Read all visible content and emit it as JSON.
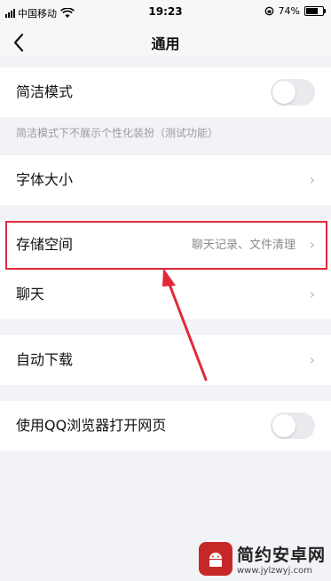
{
  "status_bar": {
    "carrier": "中国移动",
    "time": "19:23",
    "battery_text": "74%",
    "battery_level": 0.74
  },
  "nav": {
    "back_icon": "chevron-left-icon",
    "title": "通用"
  },
  "settings": {
    "simple_mode": {
      "label": "简洁模式",
      "enabled": false
    },
    "simple_mode_hint": "简洁模式下不展示个性化装扮（测试功能）",
    "font_size": {
      "label": "字体大小"
    },
    "storage": {
      "label": "存储空间",
      "value": "聊天记录、文件清理"
    },
    "chat": {
      "label": "聊天"
    },
    "auto_download": {
      "label": "自动下载"
    },
    "qq_browser": {
      "label": "使用QQ浏览器打开网页",
      "enabled": false
    }
  },
  "annotation": {
    "highlight_color": "#e1293a"
  },
  "watermark": {
    "name": "简约安卓网",
    "url": "www.jylzwyj.com"
  }
}
